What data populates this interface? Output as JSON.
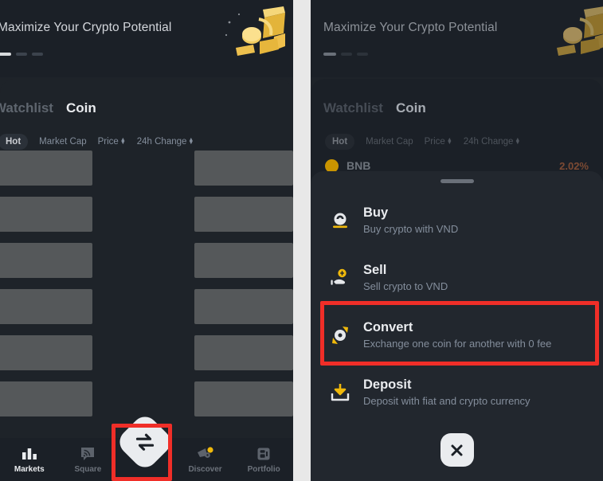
{
  "banner": {
    "title": "Maximize Your Crypto Potential",
    "art_icon": "gold-coins-illustration",
    "dots": 3,
    "active_dot": 0
  },
  "market": {
    "tabs": [
      {
        "label": "Watchlist",
        "active": false
      },
      {
        "label": "Coin",
        "active": true
      }
    ],
    "filters": [
      {
        "label": "Hot",
        "chip": true,
        "sortable": false
      },
      {
        "label": "Market Cap",
        "chip": false,
        "sortable": false
      },
      {
        "label": "Price",
        "chip": false,
        "sortable": true
      },
      {
        "label": "24h Change",
        "chip": false,
        "sortable": true
      }
    ],
    "partial_row": {
      "symbol": "BNB",
      "change": "2.02%"
    }
  },
  "tabbar": {
    "items": [
      {
        "label": "Markets",
        "icon": "bar-chart-icon",
        "active": true
      },
      {
        "label": "Square",
        "icon": "square-feed-icon",
        "active": false
      },
      {
        "label": "Discover",
        "icon": "discover-icon",
        "active": false
      },
      {
        "label": "Portfolio",
        "icon": "portfolio-icon",
        "active": false
      }
    ],
    "fab": {
      "icon": "swap-arrows-icon",
      "label": "Trade"
    }
  },
  "action_sheet": {
    "grabber": "drag-handle",
    "items": [
      {
        "title": "Buy",
        "subtitle": "Buy crypto with VND",
        "icon": "buy-coin-icon",
        "highlighted": false
      },
      {
        "title": "Sell",
        "subtitle": "Sell crypto to VND",
        "icon": "sell-hand-coin-icon",
        "highlighted": false
      },
      {
        "title": "Convert",
        "subtitle": "Exchange one coin for another with 0 fee",
        "icon": "convert-icon",
        "highlighted": true
      },
      {
        "title": "Deposit",
        "subtitle": "Deposit with fiat and crypto currency",
        "icon": "deposit-arrow-icon",
        "highlighted": false
      }
    ],
    "close_button": {
      "icon": "close-icon",
      "label": "Close"
    }
  },
  "annotations": {
    "highlight_color": "#f02e28",
    "boxes": [
      {
        "target": "trade-fab",
        "panel": "left"
      },
      {
        "target": "convert-row",
        "panel": "right"
      }
    ]
  },
  "colors": {
    "background": "#1e2329",
    "surface": "#22272e",
    "accent_gold": "#f0b90b",
    "text_primary": "#eaecef",
    "text_secondary": "#848e9c",
    "highlight": "#f02e28"
  }
}
